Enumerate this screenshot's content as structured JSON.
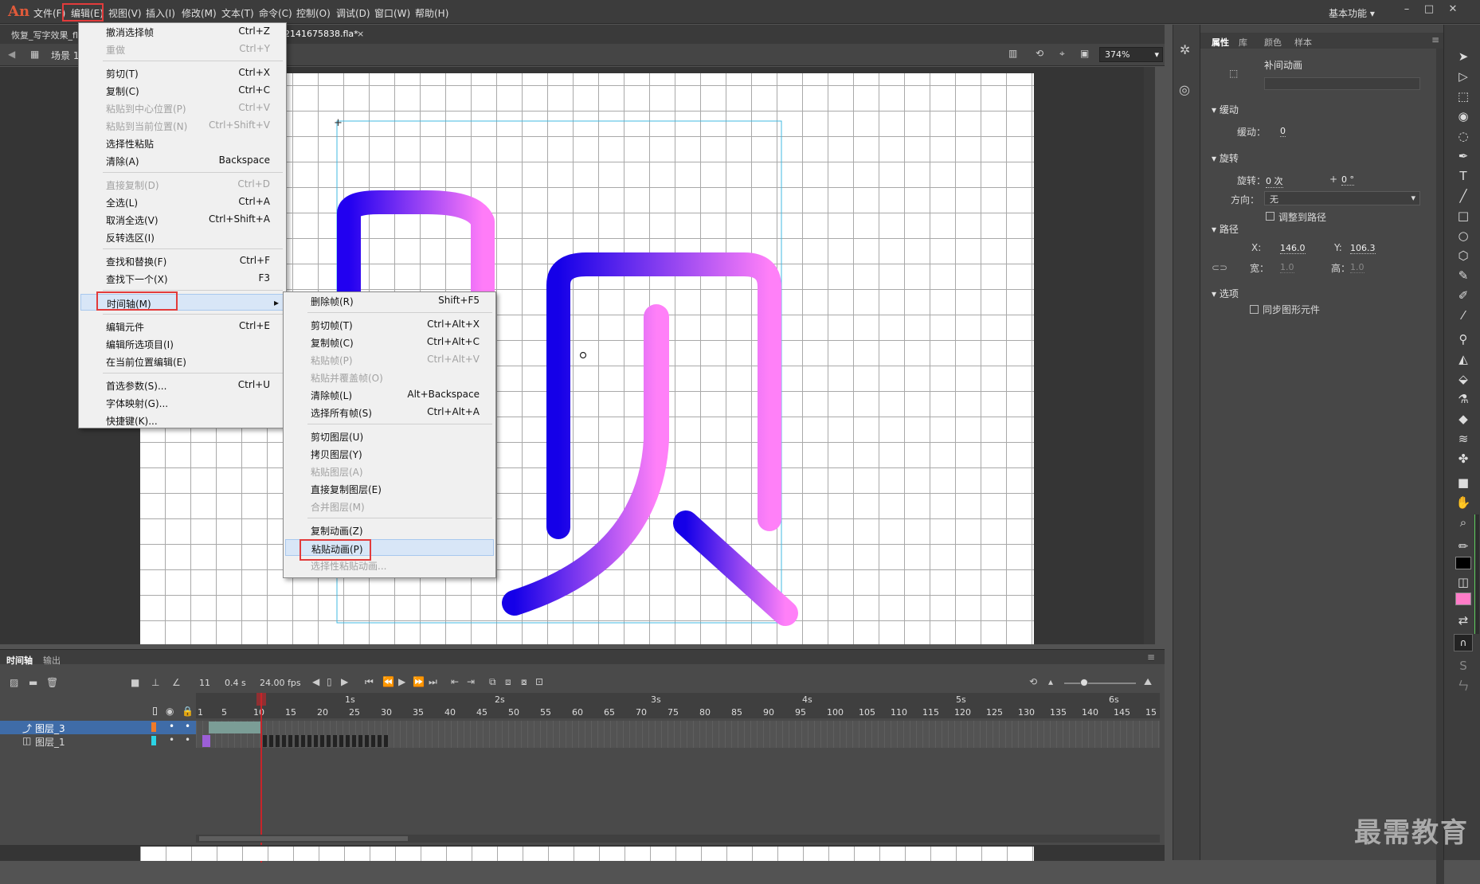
{
  "app": {
    "logo": "An",
    "workspace": "基本功能"
  },
  "menubar": {
    "items": [
      "文件(F)",
      "编辑(E)",
      "视图(V)",
      "插入(I)",
      "修改(M)",
      "文本(T)",
      "命令(C)",
      "控制(O)",
      "调试(D)",
      "窗口(W)",
      "帮助(H)"
    ]
  },
  "doctabs": {
    "tab1": "恢复_写字效果_fl",
    "tab2": "2141675838.fla*",
    "close": "×"
  },
  "editbar": {
    "scene": "场景 1",
    "zoom": "374%"
  },
  "edit_menu": {
    "items": [
      {
        "label": "撤消选择帧",
        "shortcut": "Ctrl+Z",
        "disabled": false
      },
      {
        "label": "重做",
        "shortcut": "Ctrl+Y",
        "disabled": true
      },
      {
        "label": "剪切(T)",
        "shortcut": "Ctrl+X",
        "disabled": false
      },
      {
        "label": "复制(C)",
        "shortcut": "Ctrl+C",
        "disabled": false
      },
      {
        "label": "粘贴到中心位置(P)",
        "shortcut": "Ctrl+V",
        "disabled": true
      },
      {
        "label": "粘贴到当前位置(N)",
        "shortcut": "Ctrl+Shift+V",
        "disabled": true
      },
      {
        "label": "选择性粘贴",
        "shortcut": "",
        "disabled": false
      },
      {
        "label": "清除(A)",
        "shortcut": "Backspace",
        "disabled": false
      },
      {
        "label": "直接复制(D)",
        "shortcut": "Ctrl+D",
        "disabled": true
      },
      {
        "label": "全选(L)",
        "shortcut": "Ctrl+A",
        "disabled": false
      },
      {
        "label": "取消全选(V)",
        "shortcut": "Ctrl+Shift+A",
        "disabled": false
      },
      {
        "label": "反转选区(I)",
        "shortcut": "",
        "disabled": false
      },
      {
        "label": "查找和替换(F)",
        "shortcut": "Ctrl+F",
        "disabled": false
      },
      {
        "label": "查找下一个(X)",
        "shortcut": "F3",
        "disabled": false
      },
      {
        "label": "时间轴(M)",
        "shortcut": "",
        "disabled": false
      },
      {
        "label": "编辑元件",
        "shortcut": "Ctrl+E",
        "disabled": false
      },
      {
        "label": "编辑所选项目(I)",
        "shortcut": "",
        "disabled": false
      },
      {
        "label": "在当前位置编辑(E)",
        "shortcut": "",
        "disabled": false
      },
      {
        "label": "首选参数(S)...",
        "shortcut": "Ctrl+U",
        "disabled": false
      },
      {
        "label": "字体映射(G)...",
        "shortcut": "",
        "disabled": false
      },
      {
        "label": "快捷键(K)...",
        "shortcut": "",
        "disabled": false
      }
    ]
  },
  "timeline_menu": {
    "items": [
      {
        "label": "删除帧(R)",
        "shortcut": "Shift+F5",
        "disabled": false
      },
      {
        "label": "剪切帧(T)",
        "shortcut": "Ctrl+Alt+X",
        "disabled": false
      },
      {
        "label": "复制帧(C)",
        "shortcut": "Ctrl+Alt+C",
        "disabled": false
      },
      {
        "label": "粘贴帧(P)",
        "shortcut": "Ctrl+Alt+V",
        "disabled": true
      },
      {
        "label": "粘贴并覆盖帧(O)",
        "shortcut": "",
        "disabled": true
      },
      {
        "label": "清除帧(L)",
        "shortcut": "Alt+Backspace",
        "disabled": false
      },
      {
        "label": "选择所有帧(S)",
        "shortcut": "Ctrl+Alt+A",
        "disabled": false
      },
      {
        "label": "剪切图层(U)",
        "shortcut": "",
        "disabled": false
      },
      {
        "label": "拷贝图层(Y)",
        "shortcut": "",
        "disabled": false
      },
      {
        "label": "粘贴图层(A)",
        "shortcut": "",
        "disabled": true
      },
      {
        "label": "直接复制图层(E)",
        "shortcut": "",
        "disabled": false
      },
      {
        "label": "合并图层(M)",
        "shortcut": "",
        "disabled": true
      },
      {
        "label": "复制动画(Z)",
        "shortcut": "",
        "disabled": false
      },
      {
        "label": "粘贴动画(P)",
        "shortcut": "",
        "disabled": false
      },
      {
        "label": "选择性粘贴动画...",
        "shortcut": "",
        "disabled": true
      }
    ]
  },
  "properties": {
    "tabs": [
      "属性",
      "库",
      "颜色",
      "样本"
    ],
    "title": "补间动画",
    "easing_section": "缓动",
    "easing_label": "缓动：",
    "easing_value": "0",
    "rotate_section": "旋转",
    "rotate_label": "旋转：",
    "rotate_count": "0 次",
    "rotate_plus": "+",
    "rotate_deg": "0 °",
    "direction_label": "方向：",
    "direction_value": "无",
    "orient_path": "调整到路径",
    "path_section": "路径",
    "x_label": "X:",
    "x_value": "146.0",
    "y_label": "Y:",
    "y_value": "106.3",
    "w_label": "宽：",
    "w_value": "1.0",
    "h_label": "高：",
    "h_value": "1.0",
    "options_section": "选项",
    "sync": "同步图形元件"
  },
  "timeline": {
    "tab_timeline": "时间轴",
    "tab_output": "输出",
    "frame": "11",
    "time": "0.4 s",
    "fps": "24.00 fps",
    "seconds": [
      "1s",
      "2s",
      "3s",
      "4s",
      "5s",
      "6s"
    ],
    "frames": [
      "1",
      "5",
      "10",
      "15",
      "20",
      "25",
      "30",
      "35",
      "40",
      "45",
      "50",
      "55",
      "60",
      "65",
      "70",
      "75",
      "80",
      "85",
      "90",
      "95",
      "100",
      "105",
      "110",
      "115",
      "120",
      "125",
      "130",
      "135",
      "140",
      "145",
      "15"
    ],
    "layers": [
      {
        "name": "图层_3",
        "color": "#f07a28",
        "selected": true
      },
      {
        "name": "图层_1",
        "color": "#2bd4e6",
        "selected": false
      }
    ]
  },
  "glyph": {
    "char": "帧",
    "colors": {
      "start": "#2200f0",
      "end": "#ff7cf8"
    }
  },
  "watermark": "最需教育"
}
